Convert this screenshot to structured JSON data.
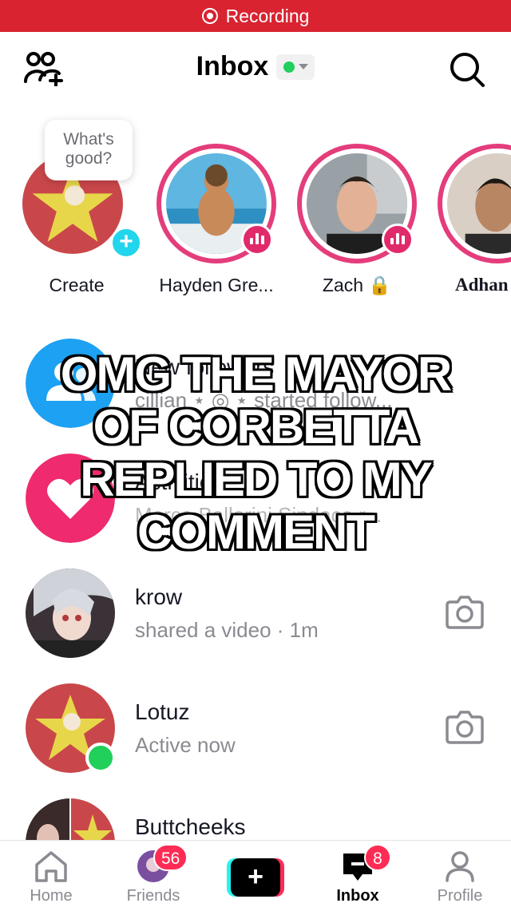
{
  "recording": {
    "label": "Recording"
  },
  "header": {
    "title": "Inbox"
  },
  "stories": [
    {
      "name": "Create",
      "bubble": "What's good?"
    },
    {
      "name": "Hayden Gre..."
    },
    {
      "name": "Zach 🔒"
    },
    {
      "name": "Adhan"
    }
  ],
  "list": [
    {
      "title": "New followers",
      "subtitle": "cillian ⋆ ◎ ⋆ started follow..."
    },
    {
      "title": "Activities",
      "subtitle": "Marco Ballarini Sindaco r..."
    },
    {
      "title": "krow",
      "subtitle": "shared a video · 1m"
    },
    {
      "title": "Lotuz",
      "subtitle": "Active now"
    },
    {
      "title": "Buttcheeks",
      "subtitle": ""
    }
  ],
  "caption": {
    "lines": [
      "OMG THE MAYOR",
      "OF CORBETTA",
      "REPLIED TO MY",
      "COMMENT"
    ]
  },
  "nav": {
    "home": "Home",
    "friends": "Friends",
    "friends_badge": "56",
    "create": "+",
    "inbox": "Inbox",
    "inbox_badge": "8",
    "profile": "Profile"
  },
  "colors": {
    "recording_bar": "#d92331",
    "story_ring": "#e43d7b",
    "accent_red": "#fe2c55",
    "online": "#20d05b",
    "follow_blue": "#1da1f2"
  }
}
